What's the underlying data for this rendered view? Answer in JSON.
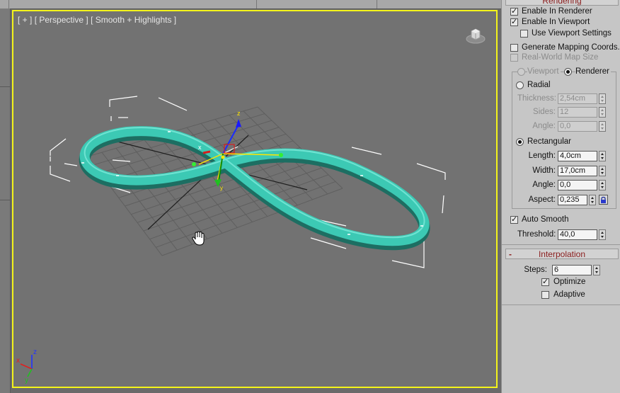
{
  "viewport": {
    "label_plus": "[ + ]",
    "label_view": "[ Perspective ]",
    "label_shading": "[ Smooth + Highlights ]",
    "axis_x": "x",
    "axis_y": "y",
    "axis_z": "z",
    "gizmo_x": "x",
    "gizmo_z": "z",
    "gizmo_y": "y"
  },
  "rendering": {
    "title": "Rendering",
    "enable_in_renderer": {
      "label": "Enable In Renderer",
      "checked": true
    },
    "enable_in_viewport": {
      "label": "Enable In Viewport",
      "checked": true
    },
    "use_viewport_settings": {
      "label": "Use Viewport Settings",
      "checked": false
    },
    "generate_mapping": {
      "label": "Generate Mapping Coords.",
      "checked": false
    },
    "real_world_map": {
      "label": "Real-World Map Size",
      "checked": false
    },
    "mode_viewport": "Viewport",
    "mode_renderer": "Renderer",
    "radial": "Radial",
    "thickness_label": "Thickness:",
    "thickness_value": "2,54cm",
    "sides_label": "Sides:",
    "sides_value": "12",
    "angle_label": "Angle:",
    "angle_value": "0,0",
    "rectangular": "Rectangular",
    "length_label": "Length:",
    "length_value": "4,0cm",
    "width_label": "Width:",
    "width_value": "17,0cm",
    "rect_angle_label": "Angle:",
    "rect_angle_value": "0,0",
    "aspect_label": "Aspect:",
    "aspect_value": "0,235",
    "auto_smooth": {
      "label": "Auto Smooth",
      "checked": true
    },
    "threshold_label": "Threshold:",
    "threshold_value": "40,0"
  },
  "interpolation": {
    "title": "Interpolation",
    "minus": "-",
    "steps_label": "Steps:",
    "steps_value": "6",
    "optimize": {
      "label": "Optimize",
      "checked": true
    },
    "adaptive": {
      "label": "Adaptive",
      "checked": false
    }
  },
  "colors": {
    "viewport_border": "#f4f41a",
    "ribbon": "#3cc9b4",
    "panel_bg": "#c6c6c6",
    "rollout_title_text": "#8a1c1c"
  }
}
